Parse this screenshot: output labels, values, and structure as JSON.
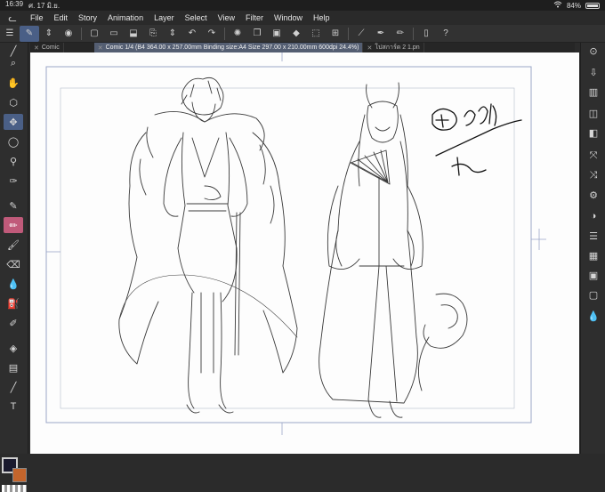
{
  "status_bar": {
    "time": "16:39",
    "date": "ศ. 17 มิ.ย.",
    "wifi_icon": "wifi-icon",
    "battery": "84%"
  },
  "menu": {
    "items": [
      "File",
      "Edit",
      "Story",
      "Animation",
      "Layer",
      "Select",
      "View",
      "Filter",
      "Window",
      "Help"
    ]
  },
  "tabs": [
    {
      "label": "Comic"
    },
    {
      "label": "Comic 1/4 (B4 364.00 x 257.00mm Binding size:A4 Size 297.00 x 210.00mm 600dpi 24.4%)"
    },
    {
      "label": "โปสการ์ด 2 1.pn"
    }
  ],
  "colors": {
    "accent": "#4a5f86",
    "main_color": "#1a1a2e",
    "sub_color": "#c4652c"
  }
}
